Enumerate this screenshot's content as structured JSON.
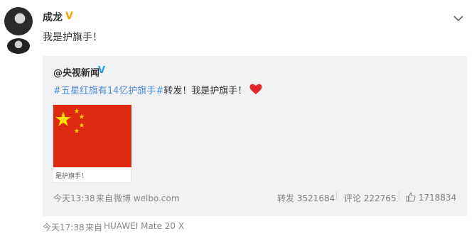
{
  "author": {
    "name": "成龙",
    "verified_mark": "V",
    "post_text": "我是护旗手！"
  },
  "repost": {
    "source_name": "@央视新闻",
    "verified_mark": "V",
    "hashtag": "#五星红旗有14亿护旗手#",
    "text": "转发！我是护旗手！",
    "image_caption": "是护旗手！",
    "time": "今天13:38",
    "from_label": "来自",
    "from_source": "微博 weibo.com",
    "repost_label": "转发",
    "repost_count": "3521684",
    "comment_label": "评论",
    "comment_count": "222765",
    "like_count": "1718834"
  },
  "footer": {
    "time": "今天17:38",
    "from_label": "来自",
    "device": "HUAWEI Mate 20 X"
  },
  "colors": {
    "hashtag": "#4e8cd6",
    "verified_blue": "#29a0e6",
    "verified_gold": "#f7a400",
    "flag_red": "#de2910",
    "flag_star": "#ffde00",
    "heart": "#e0252d"
  }
}
